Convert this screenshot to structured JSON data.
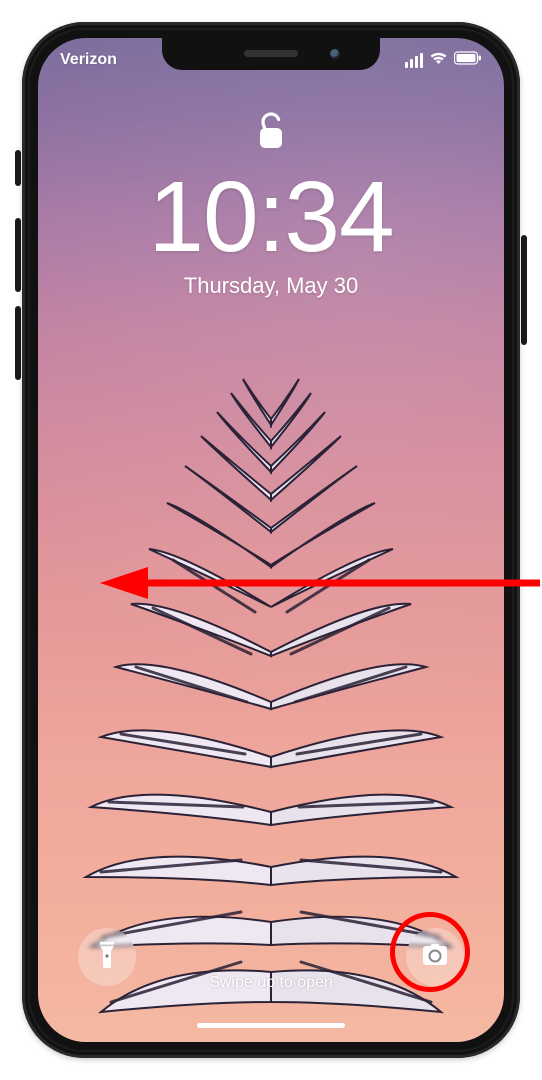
{
  "status_bar": {
    "carrier": "Verizon"
  },
  "lock_screen": {
    "time": "10:34",
    "date": "Thursday, May 30",
    "swipe_hint": "Swipe up to open"
  },
  "annotations": {
    "arrow_color": "#ff0000",
    "highlight_color": "#ff0000"
  }
}
